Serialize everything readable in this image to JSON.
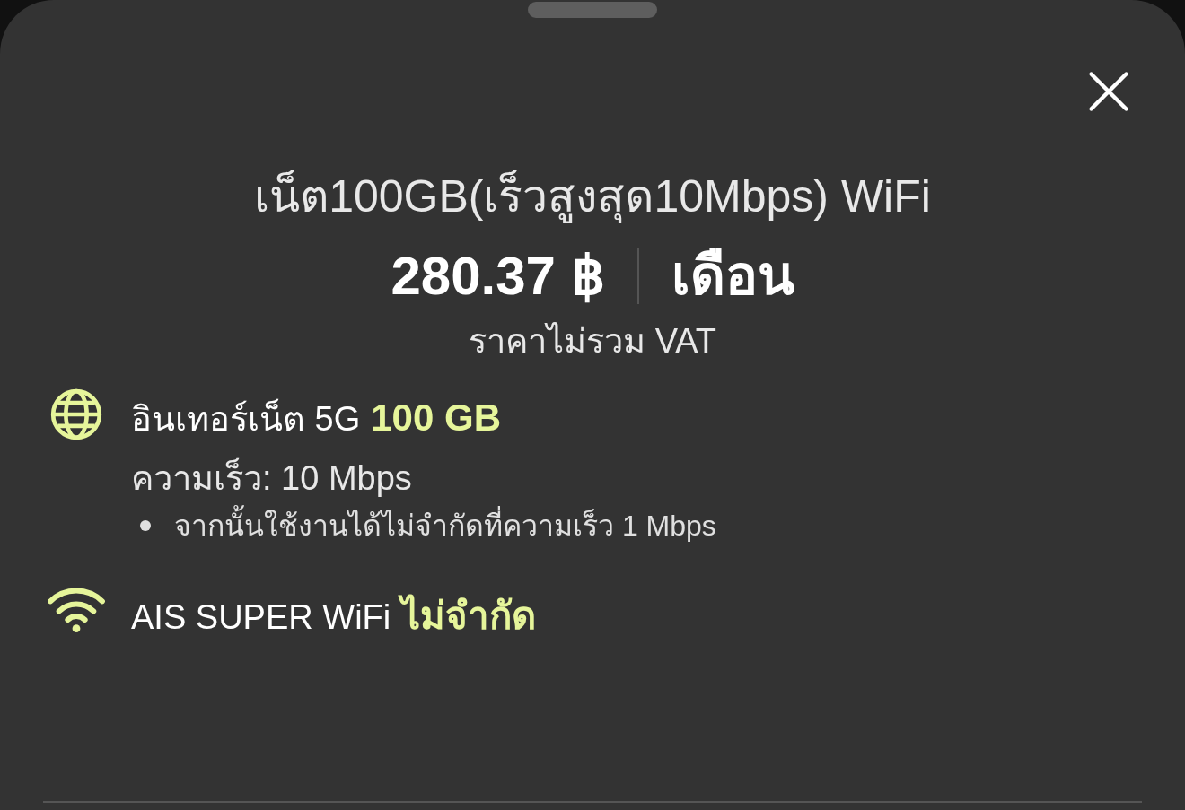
{
  "sheet": {
    "title": "เน็ต100GB(เร็วสูงสุด10Mbps) WiFi",
    "price": "280.37 ฿",
    "period": "เดือน",
    "vat_note": "ราคาไม่รวม VAT"
  },
  "features": [
    {
      "kind": "internet",
      "label": "อินเทอร์เน็ต 5G",
      "highlight": "100 GB",
      "detail": "ความเร็ว: 10 Mbps",
      "bullets": [
        "จากนั้นใช้งานได้ไม่จำกัดที่ความเร็ว 1 Mbps"
      ]
    },
    {
      "kind": "wifi",
      "label": "AIS SUPER WiFi",
      "highlight": "ไม่จำกัด"
    }
  ]
}
